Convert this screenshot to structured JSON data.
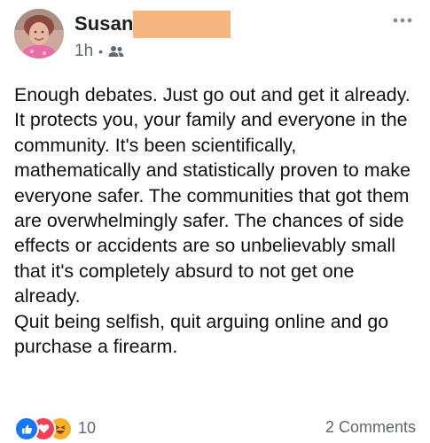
{
  "post": {
    "author_name": "Susan",
    "timestamp": "1h",
    "separator": "•",
    "audience_icon": "friends-icon",
    "more_icon": "more-options-icon",
    "body": "Enough debates. Just go out and get it already. It protects you, your family and everyone in the community. It's been scientifically, mathematically and statistically proven to make everyone safer. The communities that got them are overwhelmingly safer. The chances of side effects or accidents are so unbelievably small that it's completely absurd to not get one already.\nQuit being selfish, quit arguing online and go purchase a firearm."
  },
  "footer": {
    "reaction_icons": [
      "like-icon",
      "love-icon",
      "haha-icon"
    ],
    "reaction_count": "10",
    "comments_label": "2 Comments"
  },
  "colors": {
    "like": "#1877f2",
    "love": "#f33e58",
    "haha": "#f7b125",
    "secondary_text": "#606770",
    "redaction": "#f6b57e"
  }
}
